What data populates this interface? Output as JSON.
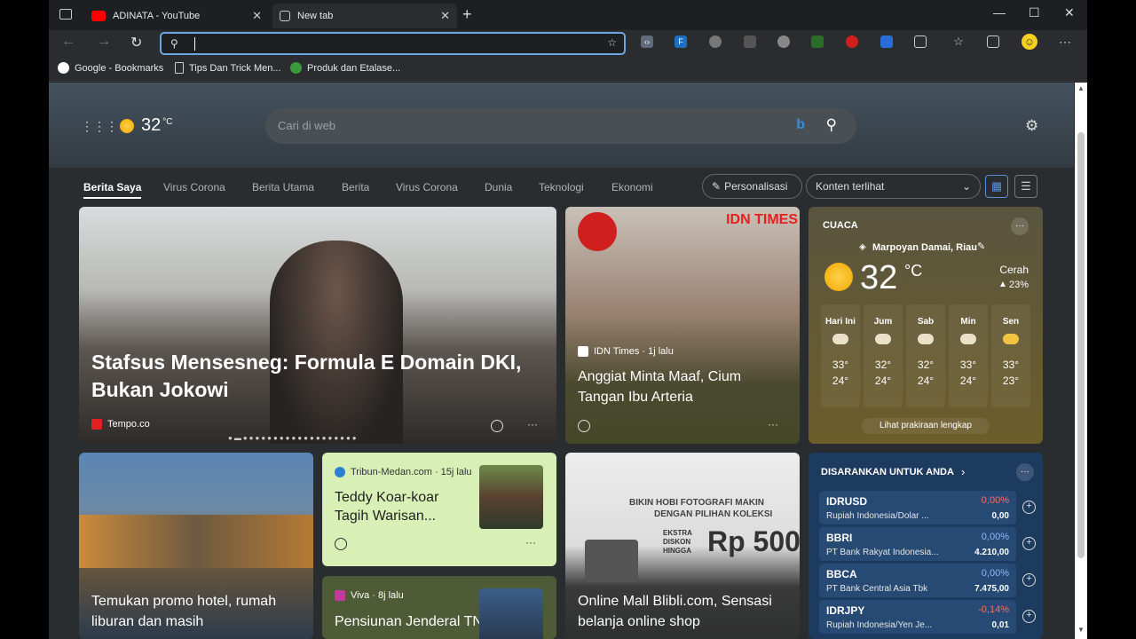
{
  "browser": {
    "tabs": [
      {
        "label": "ADINATA - YouTube",
        "active": false
      },
      {
        "label": "New tab",
        "active": true
      }
    ],
    "address_value": "",
    "bookmarks": [
      "Google - Bookmarks",
      "Tips Dan Trick Men...",
      "Produk dan Etalase..."
    ]
  },
  "header": {
    "temp": "32",
    "temp_unit": "°C",
    "search_placeholder": "Cari di web"
  },
  "nav": {
    "items": [
      "Berita Saya",
      "Virus Corona",
      "Berita Utama",
      "Berita",
      "Virus Corona",
      "Dunia",
      "Teknologi",
      "Ekonomi"
    ],
    "personalize": "Personalisasi",
    "visibility": "Konten terlihat"
  },
  "cards": {
    "main": {
      "title": "Stafsus Mensesneg: Formula E Domain DKI, Bukan Jokowi",
      "source": "Tempo.co"
    },
    "idn": {
      "source": "IDN Times · 1j lalu",
      "title": "Anggiat Minta Maaf, Cium Tangan Ibu Arteria",
      "brand": "IDN TIMES"
    },
    "hotel": {
      "title": "Temukan promo hotel, rumah liburan dan masih"
    },
    "tribun": {
      "source": "Tribun-Medan.com · 15j lalu",
      "title": "Teddy Koar-koar Tagih Warisan..."
    },
    "viva": {
      "source": "Viva · 8j lalu",
      "title": "Pensiunan Jenderal TNI Sebut Fadjroel..."
    },
    "blibli": {
      "title": "Online Mall Blibli.com, Sensasi belanja online shop",
      "banner1": "BIKIN HOBI FOTOGRAFI MAKIN",
      "banner2": "DENGAN PILIHAN KOLEKSI",
      "promo": "EKSTRA DISKON HINGGA",
      "amount": "Rp 500"
    }
  },
  "weather": {
    "heading": "CUACA",
    "location": "Marpoyan Damai, Riau",
    "temp": "32",
    "unit": "°C",
    "condition": "Cerah",
    "humidity": "23%",
    "forecast": [
      {
        "day": "Hari Ini",
        "hi": "33°",
        "lo": "24°"
      },
      {
        "day": "Jum",
        "hi": "32°",
        "lo": "24°"
      },
      {
        "day": "Sab",
        "hi": "32°",
        "lo": "24°"
      },
      {
        "day": "Min",
        "hi": "33°",
        "lo": "24°"
      },
      {
        "day": "Sen",
        "hi": "33°",
        "lo": "23°"
      }
    ],
    "link": "Lihat prakiraan lengkap"
  },
  "stocks": {
    "heading": "DISARANKAN UNTUK ANDA",
    "items": [
      {
        "sym": "IDRUSD",
        "name": "Rupiah Indonesia/Dolar ...",
        "chg": "0,00%",
        "price": "0,00",
        "color": "#ff6b6b"
      },
      {
        "sym": "BBRI",
        "name": "PT Bank Rakyat Indonesia...",
        "chg": "0,00%",
        "price": "4.210,00",
        "color": "#8fb8ff"
      },
      {
        "sym": "BBCA",
        "name": "PT Bank Central Asia Tbk",
        "chg": "0,00%",
        "price": "7.475,00",
        "color": "#8fb8ff"
      },
      {
        "sym": "IDRJPY",
        "name": "Rupiah Indonesia/Yen Je...",
        "chg": "-0,14%",
        "price": "0,01",
        "color": "#ff6b6b"
      }
    ]
  }
}
